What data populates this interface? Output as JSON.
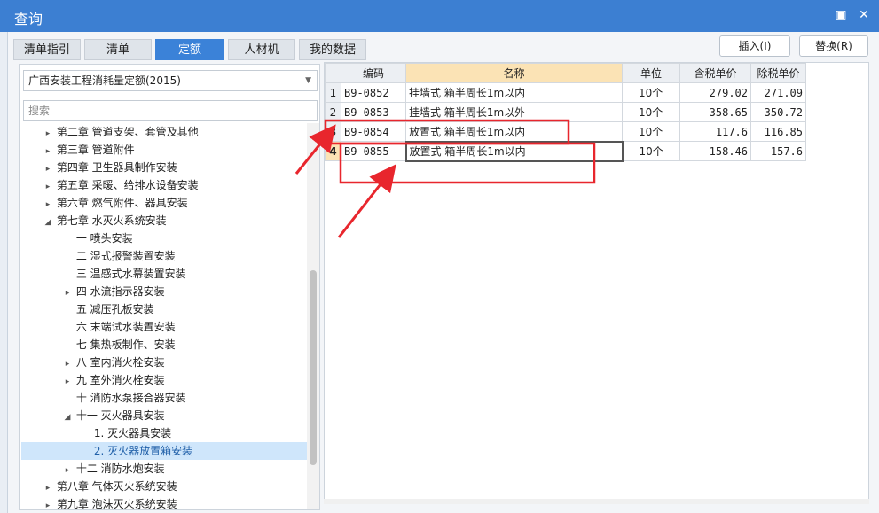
{
  "window": {
    "title": "查询"
  },
  "tabs": [
    {
      "label": "清单指引"
    },
    {
      "label": "清单"
    },
    {
      "label": "定额"
    },
    {
      "label": "人材机"
    },
    {
      "label": "我的数据"
    }
  ],
  "toolbar": {
    "insert_label": "插入(I)",
    "replace_label": "替换(R)"
  },
  "left": {
    "quota_select": "广西安装工程消耗量定额(2015)",
    "search_placeholder": "搜索",
    "tree": [
      {
        "label": "第二章  管道支架、套管及其他",
        "caret": "▸"
      },
      {
        "label": "第三章  管道附件",
        "caret": "▸"
      },
      {
        "label": "第四章  卫生器具制作安装",
        "caret": "▸"
      },
      {
        "label": "第五章  采暖、给排水设备安装",
        "caret": "▸"
      },
      {
        "label": "第六章  燃气附件、器具安装",
        "caret": "▸"
      },
      {
        "label": "第七章  水灭火系统安装",
        "caret": "◢"
      },
      {
        "label": "一  喷头安装",
        "caret": ""
      },
      {
        "label": "二  湿式报警装置安装",
        "caret": ""
      },
      {
        "label": "三  温感式水幕装置安装",
        "caret": ""
      },
      {
        "label": "四  水流指示器安装",
        "caret": "▸"
      },
      {
        "label": "五  减压孔板安装",
        "caret": ""
      },
      {
        "label": "六  末端试水装置安装",
        "caret": ""
      },
      {
        "label": "七  集热板制作、安装",
        "caret": ""
      },
      {
        "label": "八  室内消火栓安装",
        "caret": "▸"
      },
      {
        "label": "九  室外消火栓安装",
        "caret": "▸"
      },
      {
        "label": "十  消防水泵接合器安装",
        "caret": ""
      },
      {
        "label": "十一  灭火器具安装",
        "caret": "◢"
      },
      {
        "label": "1.  灭火器具安装",
        "caret": ""
      },
      {
        "label": "2.  灭火器放置箱安装",
        "caret": ""
      },
      {
        "label": "十二  消防水炮安装",
        "caret": "▸"
      },
      {
        "label": "第八章  气体灭火系统安装",
        "caret": "▸"
      },
      {
        "label": "第九章  泡沫灭火系统安装",
        "caret": "▸"
      }
    ]
  },
  "grid": {
    "headers": [
      "",
      "编码",
      "名称",
      "单位",
      "含税单价",
      "除税单价"
    ],
    "rows": [
      {
        "n": "1",
        "code": "B9-0852",
        "name": "挂墙式 箱半周长1m以内",
        "unit": "10个",
        "tax": "279.02",
        "notax": "271.09"
      },
      {
        "n": "2",
        "code": "B9-0853",
        "name": "挂墙式 箱半周长1m以外",
        "unit": "10个",
        "tax": "358.65",
        "notax": "350.72"
      },
      {
        "n": "3",
        "code": "B9-0854",
        "name": "放置式 箱半周长1m以内",
        "unit": "10个",
        "tax": "117.6",
        "notax": "116.85"
      },
      {
        "n": "4",
        "code": "B9-0855",
        "name": "放置式 箱半周长1m以内",
        "unit": "10个",
        "tax": "158.46",
        "notax": "157.6"
      }
    ]
  },
  "colors": {
    "accent": "#3b82d8",
    "titlebar": "#3c7fd2",
    "highlight_box": "#e8262d",
    "header_highlight": "#fbe3b5"
  }
}
